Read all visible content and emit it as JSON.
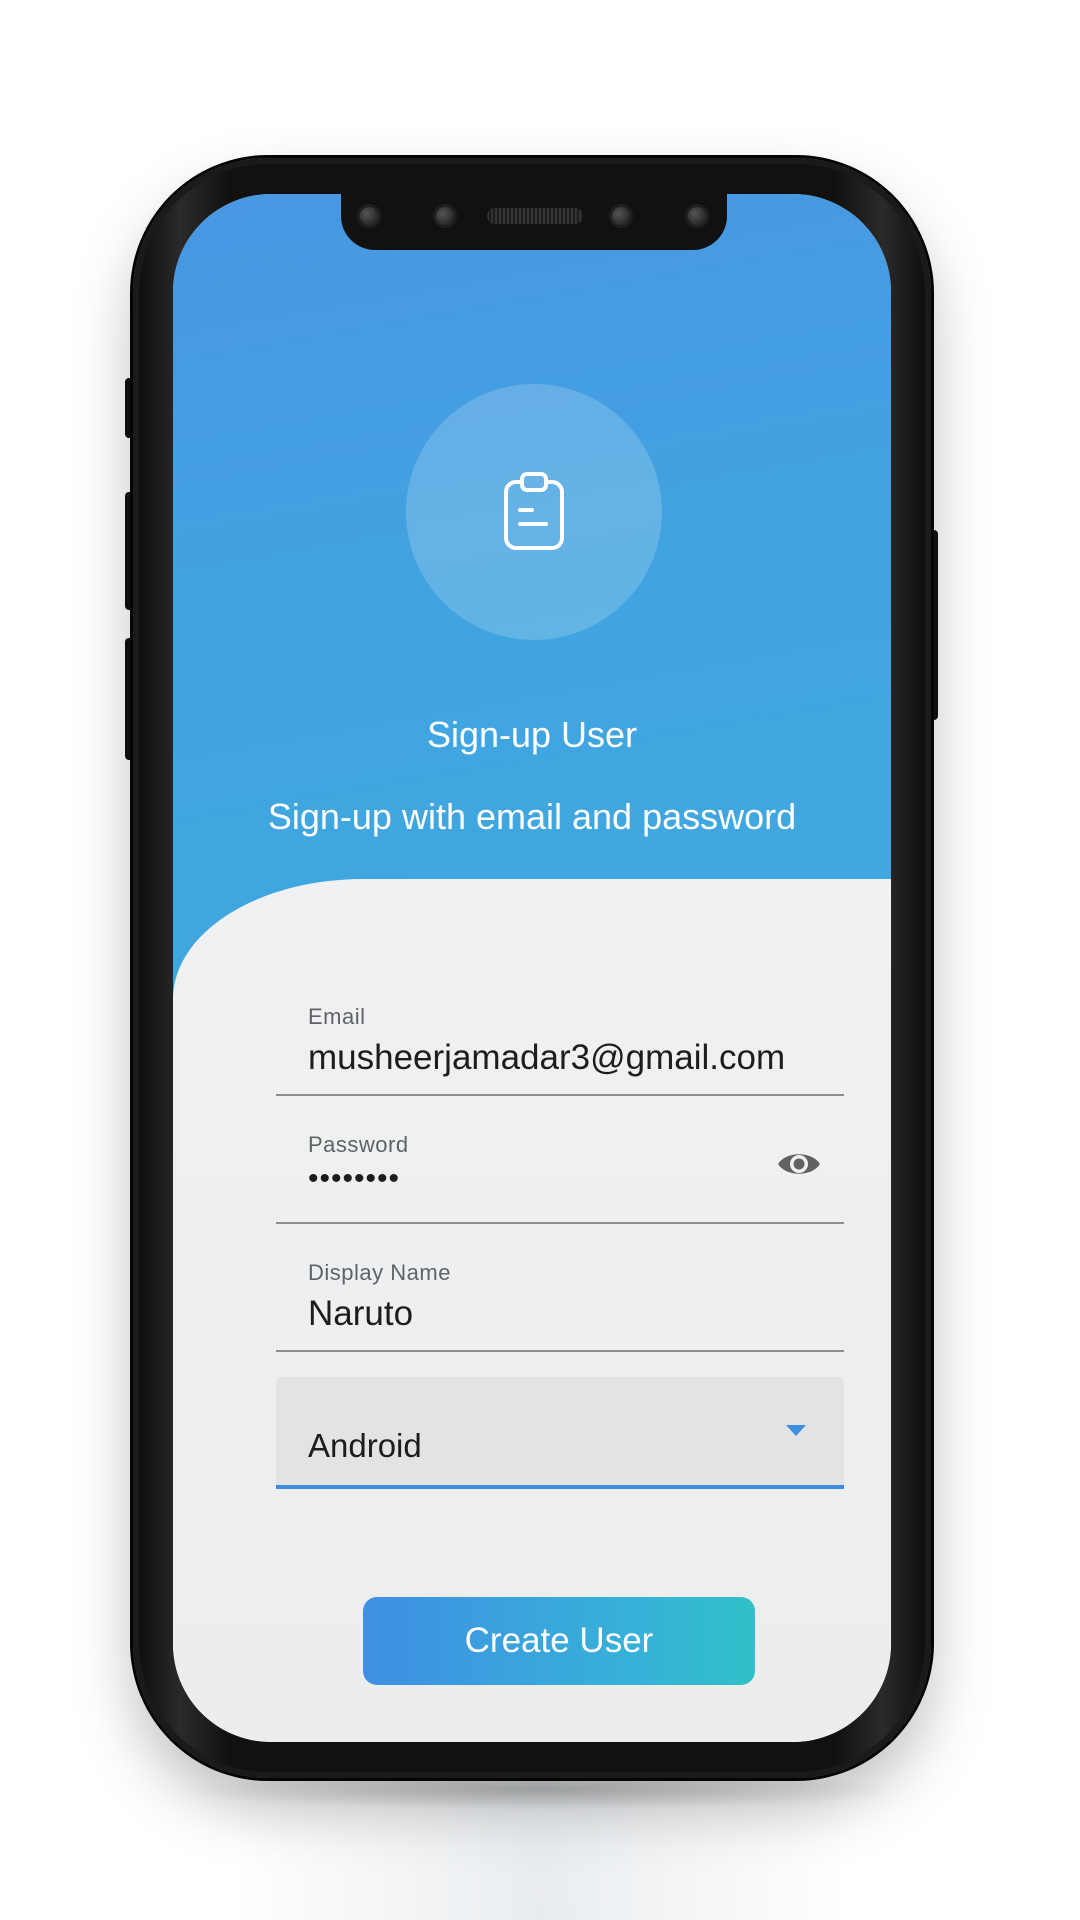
{
  "header": {
    "title": "Sign-up User",
    "subtitle": "Sign-up with email and password",
    "logo_icon": "clipboard-icon"
  },
  "form": {
    "email": {
      "label": "Email",
      "value": "musheerjamadar3@gmail.com"
    },
    "password": {
      "label": "Password",
      "value": "••••••••",
      "visibility_icon": "eye-icon"
    },
    "display_name": {
      "label": "Display Name",
      "value": "Naruto"
    },
    "platform": {
      "value": "Android",
      "icon": "arrow-drop-down-icon"
    },
    "submit_label": "Create User"
  },
  "colors": {
    "header_gradient_start": "#4897e3",
    "header_gradient_end": "#3fa9de",
    "accent": "#3d8fe0",
    "button_gradient_start": "#3f8fe3",
    "button_gradient_end": "#31c0c9",
    "form_background": "#eef0f1"
  }
}
